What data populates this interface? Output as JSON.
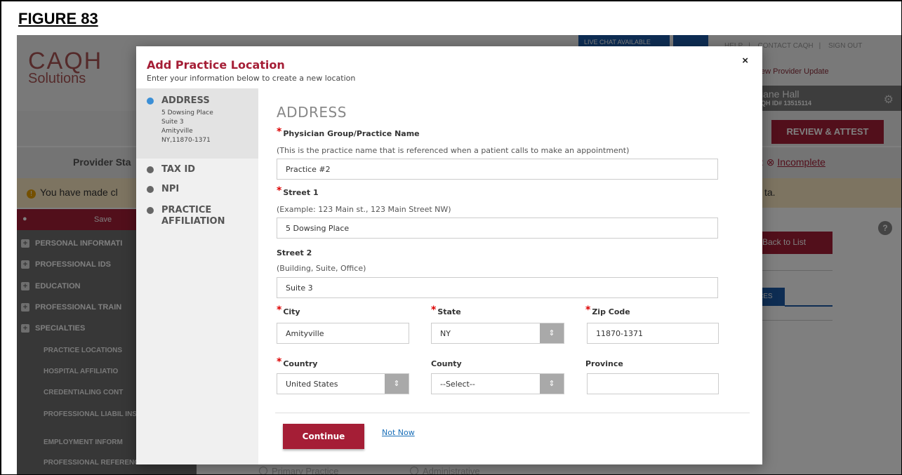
{
  "figure_title": "FIGURE 83",
  "background": {
    "logo_line1": "CAQH",
    "logo_line2": "Solutions",
    "live_chat": "LIVE CHAT AVAILABLE",
    "top_links": [
      "HELP",
      "CONTACT CAQH",
      "SIGN OUT"
    ],
    "provider_update": "ew Provider Update",
    "user_name": "iane Hall",
    "user_id": "QH ID# 13515114",
    "review_attest": "REVIEW & ATTEST",
    "provider_status": "Provider Sta",
    "incomplete_prefix": ":",
    "incomplete": "Incomplete",
    "warning_text": "You have made cl",
    "warning_right": "ta.",
    "save": "Save",
    "sidebar_sections": [
      "PERSONAL INFORMATI",
      "PROFESSIONAL IDS",
      "EDUCATION",
      "PROFESSIONAL TRAIN",
      "SPECIALTIES"
    ],
    "sidebar_subitems": [
      "PRACTICE LOCATIONS",
      "HOSPITAL AFFILIATIO",
      "CREDENTIALING CONT",
      "PROFESSIONAL LIABIL INSURANCE",
      "EMPLOYMENT INFORM",
      "PROFESSIONAL REFERENCES"
    ],
    "back_to_list": "Back to List",
    "ces_tab": "CES",
    "radio_primary": "Primary Practice",
    "radio_admin": "Administrative"
  },
  "modal": {
    "title": "Add Practice Location",
    "subtitle": "Enter your information below to create a new location",
    "close": "×",
    "steps": [
      {
        "label": "ADDRESS",
        "address_lines": [
          "5 Dowsing Place",
          "Suite 3",
          "Amityville",
          "NY,11870-1371"
        ]
      },
      {
        "label": "TAX ID"
      },
      {
        "label": "NPI"
      },
      {
        "label": "PRACTICE AFFILIATION"
      }
    ],
    "section_title": "ADDRESS",
    "fields": {
      "practice_name": {
        "label": "Physician Group/Practice Name",
        "hint": "(This is the practice name that is referenced when a patient calls to make an appointment)",
        "value": "Practice #2"
      },
      "street1": {
        "label": "Street 1",
        "hint": "(Example: 123 Main st., 123 Main Street NW)",
        "value": "5 Dowsing Place"
      },
      "street2": {
        "label": "Street 2",
        "hint": "(Building, Suite, Office)",
        "value": "Suite 3"
      },
      "city": {
        "label": "City",
        "value": "Amityville"
      },
      "state": {
        "label": "State",
        "value": "NY"
      },
      "zip": {
        "label": "Zip Code",
        "value": "11870-1371"
      },
      "country": {
        "label": "Country",
        "value": "United States"
      },
      "county": {
        "label": "County",
        "value": "--Select--"
      },
      "province": {
        "label": "Province",
        "value": ""
      }
    },
    "continue": "Continue",
    "not_now": "Not Now"
  },
  "colors": {
    "brand": "#a51e36",
    "link": "#1a6fb8",
    "active_step": "#3b8fd6"
  }
}
